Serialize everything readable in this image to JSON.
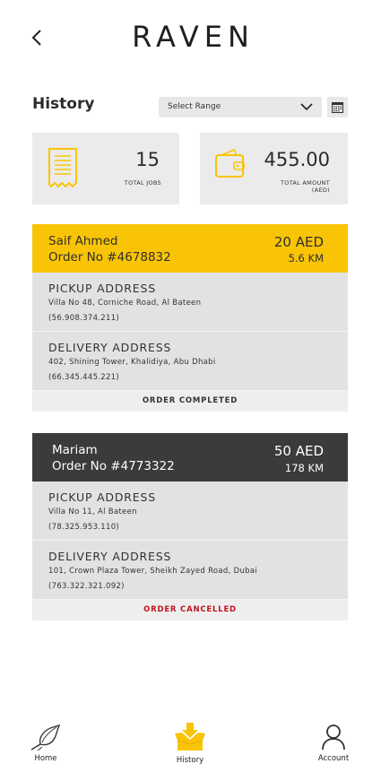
{
  "header": {
    "brand": "RAVEN",
    "back_icon": "chevron-left-icon"
  },
  "history": {
    "title": "History",
    "range_select_value": "Select Range",
    "calendar_icon": "calendar-icon"
  },
  "stats": {
    "total_jobs_value": "15",
    "total_jobs_label": "TOTAL JOBS",
    "total_amount_value": "455.00",
    "total_amount_label_line1": "TOTAL AMOUNT",
    "total_amount_label_line2": "(AED)"
  },
  "orders": [
    {
      "customer": "Saif Ahmed",
      "order_no": "Order No #4678832",
      "amount": "20 AED",
      "distance": "5.6 KM",
      "pickup_title": "PICKUP ADDRESS",
      "pickup_address": "Villa No 48, Corniche Road, Al Bateen",
      "pickup_phone": "(56.908.374.211)",
      "delivery_title": "DELIVERY ADDRESS",
      "delivery_address": "402, Shining Tower, Khalidiya, Abu Dhabi",
      "delivery_phone": "(66.345.445.221)",
      "status": "ORDER COMPLETED",
      "header_color": "#f9c406"
    },
    {
      "customer": "Mariam",
      "order_no": "Order No #4773322",
      "amount": "50 AED",
      "distance": "178 KM",
      "pickup_title": "PICKUP ADDRESS",
      "pickup_address": "Villa No 11, Al Bateen",
      "pickup_phone": "(78.325.953.110)",
      "delivery_title": "DELIVERY ADDRESS",
      "delivery_address": "101, Crown Plaza Tower, Sheikh Zayed Road, Dubai",
      "delivery_phone": "(763.322.321.092)",
      "status": "ORDER CANCELLED",
      "header_color": "#3b3b3b"
    }
  ],
  "nav": {
    "items": [
      {
        "label": "Home",
        "icon": "bird-icon"
      },
      {
        "label": "History",
        "icon": "box-download-icon",
        "active": true
      },
      {
        "label": "Account",
        "icon": "user-icon"
      }
    ],
    "active_color": "#f9c406"
  }
}
